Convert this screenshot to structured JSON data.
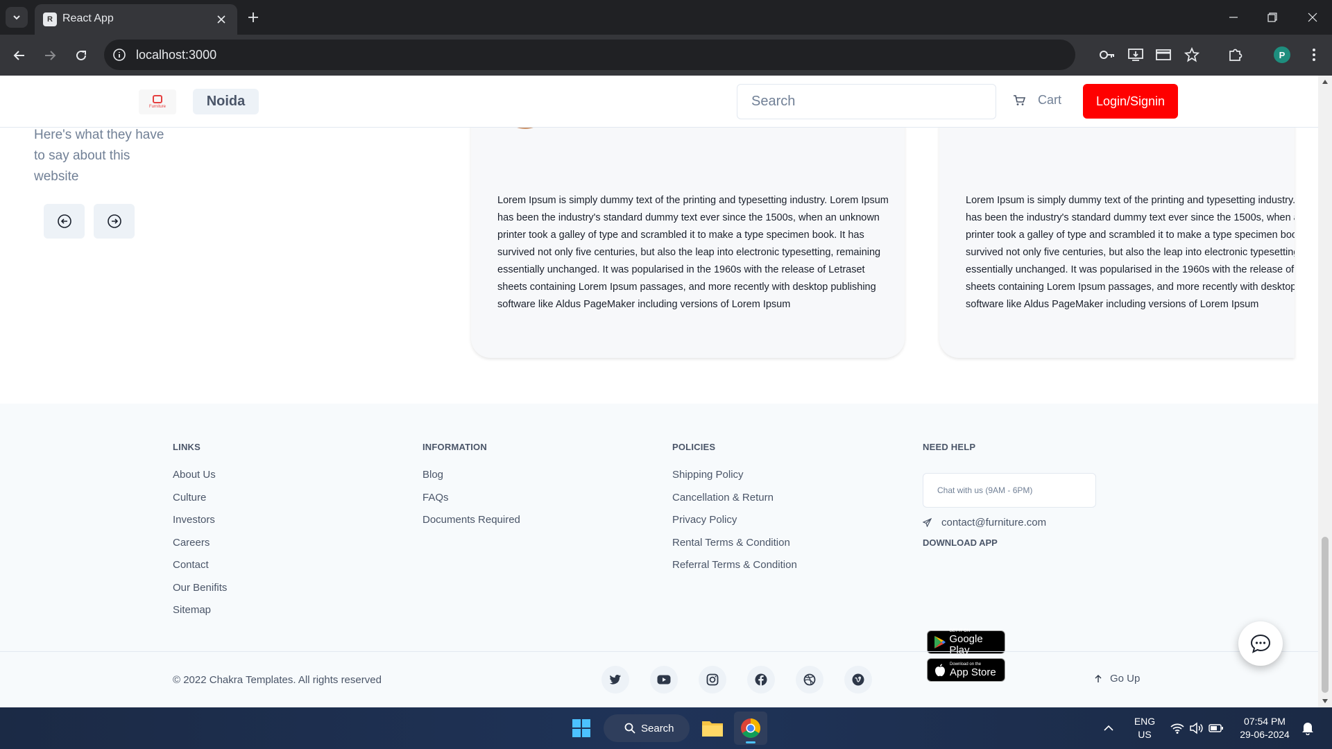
{
  "browser": {
    "tab_title": "React App",
    "url": "localhost:3000",
    "profile_initial": "P"
  },
  "header": {
    "logo_text": "Furniture",
    "city": "Noida",
    "search_placeholder": "Search",
    "cart_label": "Cart",
    "login_label": "Login/Signin"
  },
  "testimonials": {
    "intro": "Here's what they have to say about this website",
    "cards": [
      {
        "text": "Lorem Ipsum is simply dummy text of the printing and typesetting industry. Lorem Ipsum has been the industry's standard dummy text ever since the 1500s, when an unknown printer took a galley of type and scrambled it to make a type specimen book. It has survived not only five centuries, but also the leap into electronic typesetting, remaining essentially unchanged. It was popularised in the 1960s with the release of Letraset sheets containing Lorem Ipsum passages, and more recently with desktop publishing software like Aldus PageMaker including versions of Lorem Ipsum"
      },
      {
        "text": "Lorem Ipsum is simply dummy text of the printing and typesetting industry. Lorem Ipsum has been the industry's standard dummy text ever since the 1500s, when an unknown printer took a galley of type and scrambled it to make a type specimen book. It has survived not only five centuries, but also the leap into electronic typesetting, remaining essentially unchanged. It was popularised in the 1960s with the release of Letraset sheets containing Lorem Ipsum passages, and more recently with desktop publishing software like Aldus PageMaker including versions of Lorem Ipsum"
      }
    ]
  },
  "footer": {
    "links": {
      "title": "LINKS",
      "items": [
        "About Us",
        "Culture",
        "Investors",
        "Careers",
        "Contact",
        "Our Benifits",
        "Sitemap"
      ]
    },
    "information": {
      "title": "INFORMATION",
      "items": [
        "Blog",
        "FAQs",
        "Documents Required"
      ]
    },
    "policies": {
      "title": "POLICIES",
      "items": [
        "Shipping Policy",
        "Cancellation & Return",
        "Privacy Policy",
        "Rental Terms & Condition",
        "Referral Terms & Condition"
      ]
    },
    "help": {
      "title": "NEED HELP",
      "chat": "Chat with us (9AM - 6PM)",
      "email": "contact@furniture.com",
      "download_title": "DOWNLOAD APP",
      "google_small": "GET IT ON",
      "google_big": "Google Play",
      "apple_small": "Download on the",
      "apple_big": "App Store"
    },
    "copyright": "© 2022 Chakra Templates. All rights reserved",
    "go_up": "Go Up",
    "socials": [
      "twitter-icon",
      "youtube-icon",
      "instagram-icon",
      "facebook-icon",
      "dribbble-icon",
      "vimeo-icon"
    ]
  },
  "taskbar": {
    "search_label": "Search",
    "lang_top": "ENG",
    "lang_bottom": "US",
    "time": "07:54 PM",
    "date": "29-06-2024"
  },
  "colors": {
    "brand_red": "#ff0000",
    "footer_bg": "#f7fafc",
    "chrome_dark": "#202124"
  }
}
